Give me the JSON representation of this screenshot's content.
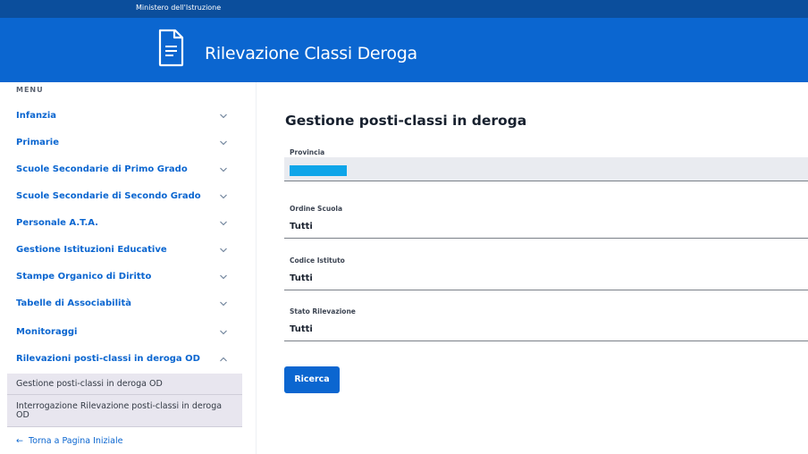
{
  "topbar": {
    "ministry": "Ministero dell'Istruzione"
  },
  "header": {
    "title": "Rilevazione Classi Deroga",
    "icon": "document-icon"
  },
  "sidebar": {
    "menu_label": "MENU",
    "items": [
      {
        "label": "Infanzia",
        "expanded": false
      },
      {
        "label": "Primarie",
        "expanded": false
      },
      {
        "label": "Scuole Secondarie di Primo Grado",
        "expanded": false
      },
      {
        "label": "Scuole Secondarie di Secondo Grado",
        "expanded": false
      },
      {
        "label": "Personale A.T.A.",
        "expanded": false
      },
      {
        "label": "Gestione Istituzioni Educative",
        "expanded": false
      },
      {
        "label": "Stampe Organico di Diritto",
        "expanded": false
      },
      {
        "label": "Tabelle di Associabilità",
        "expanded": false
      },
      {
        "label": "Monitoraggi",
        "expanded": false
      },
      {
        "label": "Rilevazioni posti-classi in deroga OD",
        "expanded": true
      }
    ],
    "sub_items": [
      {
        "label": "Gestione posti-classi in deroga OD"
      },
      {
        "label": "Interrogazione Rilevazione posti-classi in deroga OD"
      }
    ],
    "back_link": "Torna a Pagina Iniziale"
  },
  "main": {
    "title": "Gestione posti-classi in deroga",
    "fields": {
      "provincia": {
        "label": "Provincia",
        "value": ""
      },
      "ordine_scuola": {
        "label": "Ordine Scuola",
        "value": "Tutti"
      },
      "codice_istituto": {
        "label": "Codice Istituto",
        "value": "Tutti"
      },
      "stato_rilevazione": {
        "label": "Stato Rilevazione",
        "value": "Tutti"
      }
    },
    "search_button": "Ricerca"
  },
  "colors": {
    "brand": "#0b66d0",
    "topbar": "#0b4e9c",
    "highlight": "#0ea5e9"
  }
}
